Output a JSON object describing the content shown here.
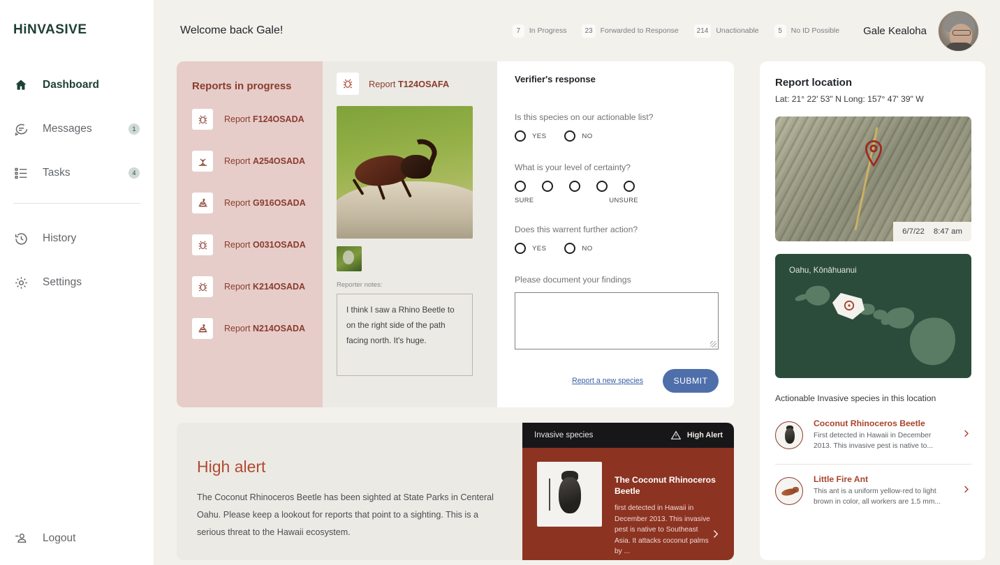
{
  "brand": "HiNVASIVE",
  "sidebar": {
    "items": [
      {
        "label": "Dashboard",
        "icon": "home-icon",
        "badge": ""
      },
      {
        "label": "Messages",
        "icon": "message-icon",
        "badge": "1"
      },
      {
        "label": "Tasks",
        "icon": "tasks-icon",
        "badge": "4"
      },
      {
        "label": "History",
        "icon": "history-icon",
        "badge": ""
      },
      {
        "label": "Settings",
        "icon": "gear-icon",
        "badge": ""
      }
    ],
    "logout": {
      "label": "Logout",
      "icon": "logout-icon"
    }
  },
  "header": {
    "welcome": "Welcome back Gale!",
    "stats": [
      {
        "count": "7",
        "label": "In Progress"
      },
      {
        "count": "23",
        "label": "Forwarded to Response"
      },
      {
        "count": "214",
        "label": "Unactionable"
      },
      {
        "count": "5",
        "label": "No ID Possible"
      }
    ],
    "user_name": "Gale Kealoha"
  },
  "reports_panel": {
    "title": "Reports in progress",
    "items": [
      {
        "prefix": "Report ",
        "id": "F124OSADA",
        "icon": "bug-icon"
      },
      {
        "prefix": "Report ",
        "id": "A254OSADA",
        "icon": "plant-icon"
      },
      {
        "prefix": "Report ",
        "id": "G916OSADA",
        "icon": "snail-icon"
      },
      {
        "prefix": "Report ",
        "id": "O031OSADA",
        "icon": "bug-icon"
      },
      {
        "prefix": "Report ",
        "id": "K214OSADA",
        "icon": "bug-icon"
      },
      {
        "prefix": "Report ",
        "id": "N214OSADA",
        "icon": "snail-icon"
      }
    ]
  },
  "report_detail": {
    "prefix": "Report ",
    "id": "T124OSAFA",
    "icon": "bug-icon",
    "notes_label": "Reporter notes:",
    "notes": "I think I saw a Rhino Beetle to on the right side of the path facing north. It's huge."
  },
  "verifier": {
    "title": "Verifier's response",
    "q1": {
      "label": "Is this species on our actionable list?",
      "options": [
        "YES",
        "NO"
      ]
    },
    "q2": {
      "label": "What is your level of certainty?",
      "count": 5,
      "low": "SURE",
      "high": "UNSURE"
    },
    "q3": {
      "label": "Does this warrent further action?",
      "options": [
        "YES",
        "NO"
      ]
    },
    "findings_label": "Please document your findings",
    "findings_value": "",
    "report_link": "Report a new species",
    "submit_label": "SUBMIT"
  },
  "high_alert": {
    "title": "High alert",
    "body": "The Coconut Rhinoceros Beetle has been sighted at State Parks in Centeral Oahu. Please keep a lookout for reports that point to a sighting. This is a serious threat to the Hawaii ecosystem.",
    "card": {
      "head_title": "Invasive species",
      "alert_label": "High Alert",
      "alert_icon": "warning-triangle-icon",
      "species_title": "The Coconut Rhinoceros Beetle",
      "species_desc": "first detected in Hawaii in December 2013. This invasive pest is native to Southeast Asia. It attacks coconut palms by ...",
      "chevron": "chevron-right-icon"
    }
  },
  "location": {
    "title": "Report location",
    "coords": "Lat: 21° 22' 53\" N  Long: 157° 47' 39\" W",
    "map_date": "6/7/22",
    "map_time": "8:47 am",
    "pin_icon": "map-pin-icon",
    "island_label": "Oahu, Kōnāhuanui",
    "species_heading": "Actionable Invasive species in this location",
    "species": [
      {
        "name": "Coconut Rhinoceros Beetle",
        "desc": "First detected in Hawaii in December 2013. This invasive pest is native to...",
        "icon": "beetle-icon"
      },
      {
        "name": "Little Fire Ant",
        "desc": "This ant is a uniform yellow-red to light brown in color, all workers are 1.5 mm...",
        "icon": "ant-icon"
      }
    ]
  },
  "colors": {
    "brand_green": "#1e4035",
    "accent_red": "#8a3b2e",
    "alert_red": "#8c3322",
    "submit_blue": "#4f6fab",
    "panel_pink": "#e6cdc9",
    "bg_cream": "#f2f1ec",
    "map_green": "#2c4c3b"
  }
}
